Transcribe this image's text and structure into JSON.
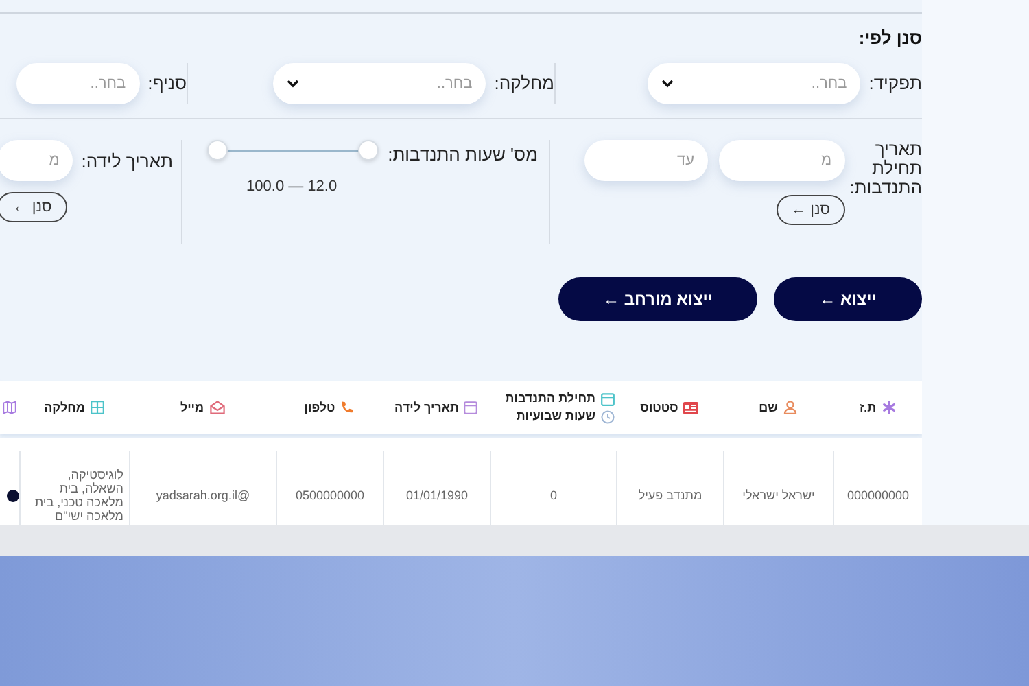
{
  "filter_title": "סנן לפי:",
  "filters_row_1": [
    {
      "label": "תפקיד:",
      "kind": "select",
      "placeholder": "בחר.."
    },
    {
      "label": "מחלקה:",
      "kind": "select",
      "placeholder": "בחר.."
    },
    {
      "label": "סניף:",
      "kind": "input",
      "placeholder": "בחר.."
    }
  ],
  "volunteer_start_filter": {
    "label": "תאריך תחילת התנדבות:",
    "from_placeholder": "מ",
    "to_placeholder": "עד",
    "button": "סנן ←"
  },
  "hours_filter": {
    "label": "מס' שעות התנדבות:",
    "thumbs": [
      {
        "level": 0
      },
      {
        "level": 1
      }
    ],
    "reading": "100.0 — 12.0"
  },
  "birth_date_filter": {
    "label": "תאריך לידה:",
    "from_placeholder": "מ",
    "button": "סנן ←"
  },
  "buttons": [
    "ייצוא ←",
    "ייצוא מורחב ←"
  ],
  "table": {
    "columns": [
      "ת.ז",
      "שם",
      "סטטוס",
      "תחילת התנדבות שעות שבועיות",
      "תאריך לידה",
      "טלפון",
      "מייל",
      "מחלקה"
    ],
    "rows": [
      [
        "000000000",
        "ישראל ישראלי",
        "מתנדב פעיל",
        "0",
        "01/01/1990",
        "0500000000",
        "@yadsarah.org.il",
        "לוגיסטיקה, השאלה, בית מלאכה טכני, בית מלאכה ישי\"ם"
      ]
    ]
  }
}
